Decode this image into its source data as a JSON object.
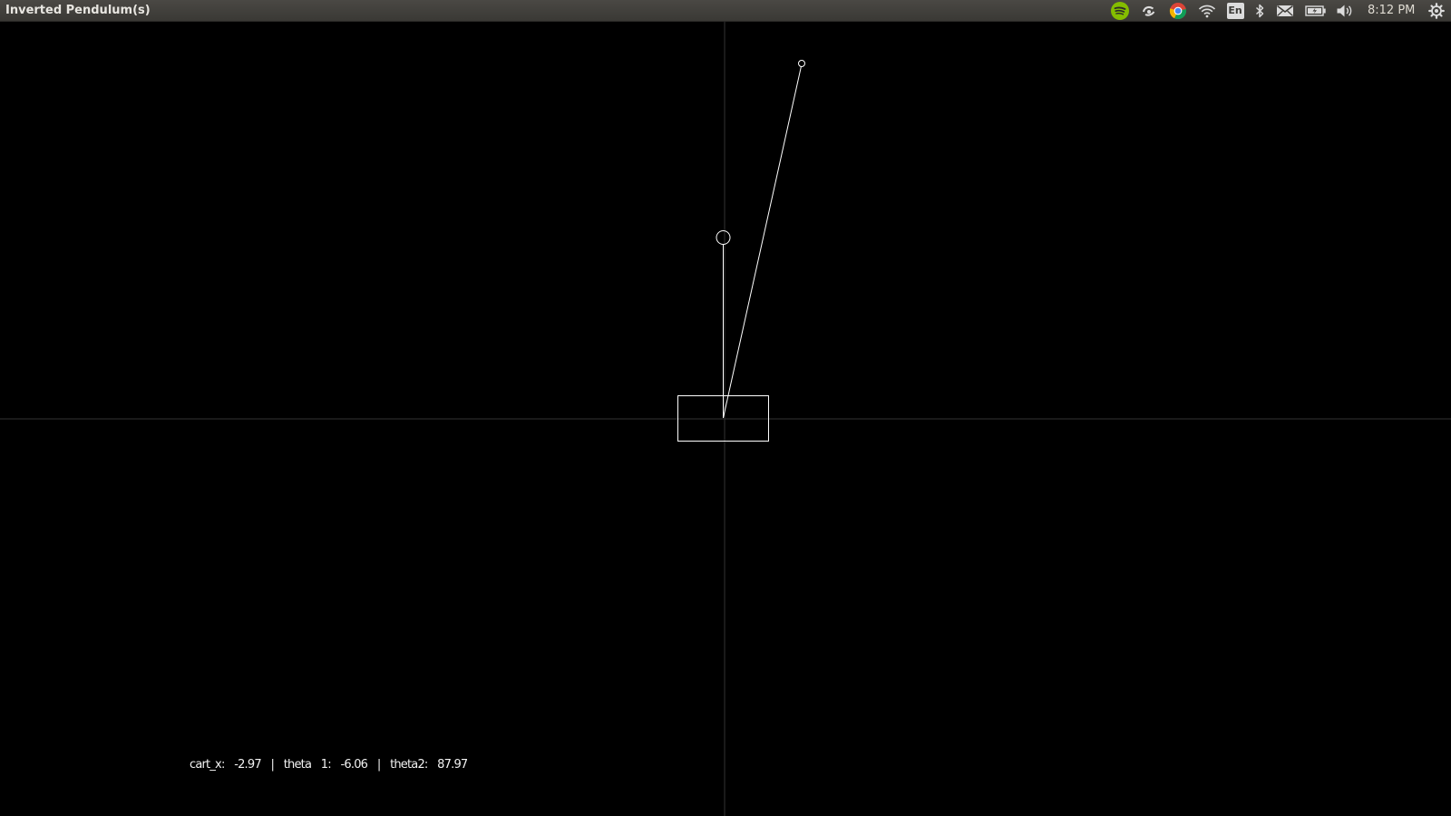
{
  "window": {
    "title": "Inverted Pendulum(s)"
  },
  "panel": {
    "indicators": [
      {
        "name": "spotify-icon"
      },
      {
        "name": "sync-icon"
      },
      {
        "name": "chrome-icon"
      },
      {
        "name": "wifi-icon"
      },
      {
        "name": "keyboard-layout-indicator",
        "label": "En"
      },
      {
        "name": "bluetooth-icon"
      },
      {
        "name": "mail-icon"
      },
      {
        "name": "battery-icon"
      },
      {
        "name": "volume-icon"
      }
    ],
    "clock": "8:12 PM",
    "session_icon": "gear-power-icon"
  },
  "simulation": {
    "readout": "cart_x:  -2.97  |  theta  1:  -6.06  |  theta2:  87.97",
    "state": {
      "cart_x": -2.97,
      "theta1": -6.06,
      "theta2": 87.97
    }
  },
  "colors": {
    "background": "#000000",
    "foreground": "#ffffff",
    "axis": "#333333",
    "panel": "#3c3b37",
    "spotify": "#84bd00"
  }
}
